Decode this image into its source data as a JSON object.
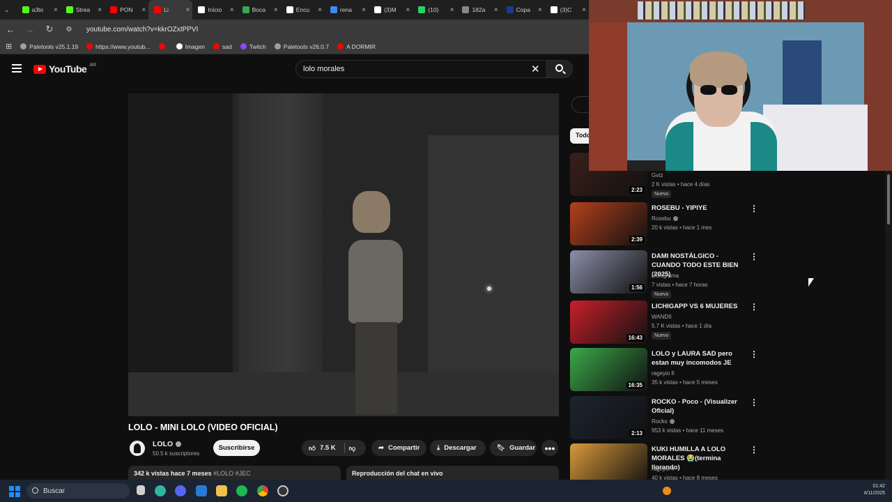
{
  "browser": {
    "tabs": [
      {
        "label": "a3to",
        "color": "#53fc18"
      },
      {
        "label": "Strea",
        "color": "#53fc18"
      },
      {
        "label": "PON",
        "color": "#ff0000"
      },
      {
        "label": "Li",
        "color": "#ff0000",
        "active": true
      },
      {
        "label": "Inicio",
        "color": "#ffffff"
      },
      {
        "label": "Boca",
        "color": "#34a853"
      },
      {
        "label": "Encu",
        "color": "#ffffff"
      },
      {
        "label": "rena",
        "color": "#4285f4"
      },
      {
        "label": "(3)M",
        "color": "#ffffff"
      },
      {
        "label": "(10)",
        "color": "#25d366"
      },
      {
        "label": "182a",
        "color": "#888888"
      },
      {
        "label": "Copa",
        "color": "#1a3a8a"
      },
      {
        "label": "(3)C",
        "color": "#ffffff"
      }
    ],
    "url": "youtube.com/watch?v=kkrOZxIPPVI",
    "bookmarks": [
      {
        "label": "Paletools v25.1.19",
        "color": "#9aa0a6"
      },
      {
        "label": "https://www.youtub...",
        "color": "#ff0000"
      },
      {
        "label": "",
        "color": "#ff0000"
      },
      {
        "label": "Imagen",
        "color": "#ffffff"
      },
      {
        "label": "sad",
        "color": "#ff0000"
      },
      {
        "label": "Twitch",
        "color": "#9146ff"
      },
      {
        "label": "Paletools v26.0.7",
        "color": "#9aa0a6"
      },
      {
        "label": "A DORMIR",
        "color": "#ff0000"
      }
    ]
  },
  "youtube": {
    "logo_text": "YouTube",
    "region": "AR",
    "search_value": "lolo morales",
    "chip_label": "Todo"
  },
  "video": {
    "title": "LOLO - MINI LOLO (VIDEO OFICIAL)",
    "channel": "LOLO",
    "subscribers": "50.5 k suscriptores",
    "subscribe_label": "Suscribirse",
    "likes": "7.5 K",
    "share_label": "Compartir",
    "download_label": "Descargar",
    "save_label": "Guardar",
    "more_label": "•••",
    "views_time": "342 k vistas  hace 7 meses",
    "tags": "#LOLO #JEC",
    "chat_label": "Reproducción del chat en vivo"
  },
  "recommendations": [
    {
      "title": "",
      "channel": "Gvtz",
      "meta": "2 K vistas • hace 4 días",
      "duration": "2:23",
      "new": "Nuevo",
      "verified": false,
      "thumb": "#3a1f1a"
    },
    {
      "title": "ROSEBU - YIPIYE",
      "channel": "Rosebu",
      "meta": "20 k vistas • hace 1 mes",
      "duration": "2:39",
      "new": "",
      "verified": true,
      "thumb": "#b5401c"
    },
    {
      "title": "DAMI NOSTÁLGICO - CUANDO TODO ESTE BIEN (2025)",
      "channel": "Holograma",
      "meta": "7 vistas • hace 7 horas",
      "duration": "1:56",
      "new": "Nuevo",
      "verified": false,
      "thumb": "#8c8fa8"
    },
    {
      "title": "LICHIGAPP VS 6 MUJERES",
      "channel": "WANDII",
      "meta": "5.7 K vistas • hace 1 día",
      "duration": "16:43",
      "new": "Nuevo",
      "verified": false,
      "thumb": "#c8202a"
    },
    {
      "title": "LOLO y LAURA SAD pero estan muy incomodos JE",
      "channel": "rageyio fr",
      "meta": "35 k vistas • hace 5 meses",
      "duration": "16:35",
      "new": "",
      "verified": false,
      "thumb": "#3ba94a"
    },
    {
      "title": "ROCKO - Poco - (Visualizer Oficial)",
      "channel": "Rocko",
      "meta": "953 k vistas • hace 11 meses",
      "duration": "2:13",
      "new": "",
      "verified": true,
      "thumb": "#1c2430"
    },
    {
      "title": "KUKI HUMILLA A LOLO MORALES 😭(termina llorando)",
      "channel": "rageyio fr",
      "meta": "40 k vistas • hace 8 meses",
      "duration": "",
      "new": "",
      "verified": false,
      "thumb": "#d89a3a"
    }
  ],
  "taskbar": {
    "search_placeholder": "Buscar",
    "clock_time": "01:42",
    "clock_date": "4/11/2025"
  }
}
